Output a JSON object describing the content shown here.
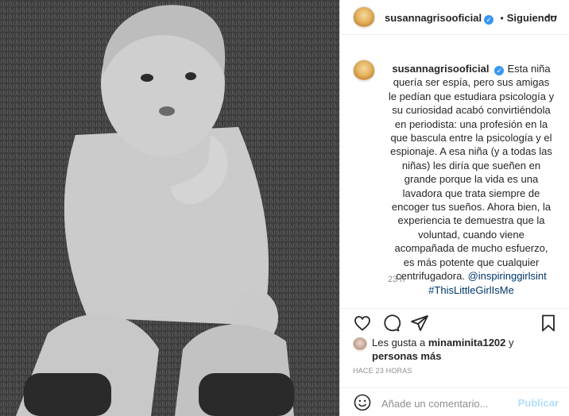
{
  "post": {
    "username": "susannagrisooficial",
    "follow_separator": "•",
    "follow_label": "Siguiendo",
    "verified_icon": "verified-badge-icon",
    "caption_text": "Esta niña quería ser espía, pero sus amigas le pedían que estudiara psicología y su curiosidad acabó convirtiéndola en periodista: una profesión en la que bascula entre la psicología y el espionaje. A esa niña (y a todas las niñas) les diría que sueñen en grande porque la vida es una lavadora que trata siempre de encoger tus sueños. Ahora bien, la experiencia te demuestra que la voluntad, cuando viene acompañada de mucho esfuerzo, es más potente que cualquier centrifugadora.",
    "hashtag_1": "@inspiringgirlsint",
    "hashtag_2": "#ThisLittleGirlIsMe",
    "caption_time": "23 h",
    "likes_prefix": "Les gusta a",
    "likes_user": "minaminita1202",
    "likes_joiner": "y",
    "likes_others": "personas más",
    "posted_ago": "HACE 23 HORAS",
    "comment_placeholder": "Añade un comentario...",
    "publish_label": "Publicar"
  },
  "icons": [
    "heart-icon",
    "comment-icon",
    "share-icon",
    "save-icon",
    "emoji-icon",
    "more-options-icon"
  ],
  "colors": {
    "link": "#00376b",
    "verified": "#3897f0",
    "publish_disabled": "#b2dffc",
    "muted": "#8e8e8e"
  }
}
